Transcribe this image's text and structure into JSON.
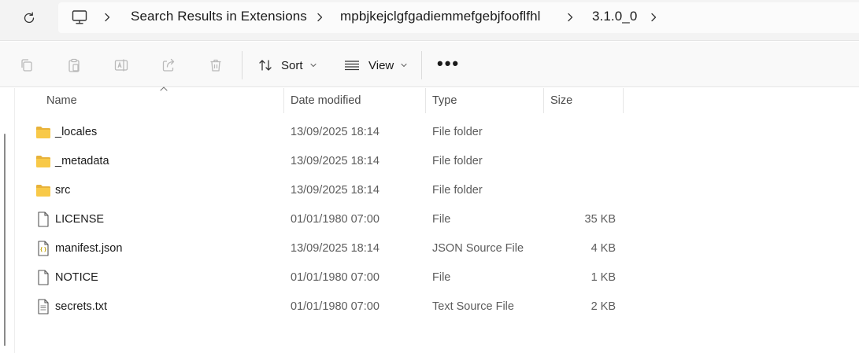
{
  "address_bar": {
    "breadcrumbs": [
      "Search Results in Extensions",
      "mpbjkejclgfgadiemmefgebjfooflfhl",
      "3.1.0_0"
    ]
  },
  "toolbar": {
    "sort_label": "Sort",
    "view_label": "View",
    "more_label": "•••"
  },
  "columns": {
    "name": "Name",
    "date_modified": "Date modified",
    "type": "Type",
    "size": "Size"
  },
  "files": [
    {
      "name": "_locales",
      "date": "13/09/2025 18:14",
      "type": "File folder",
      "size": "",
      "icon": "folder-icon"
    },
    {
      "name": "_metadata",
      "date": "13/09/2025 18:14",
      "type": "File folder",
      "size": "",
      "icon": "folder-icon"
    },
    {
      "name": "src",
      "date": "13/09/2025 18:14",
      "type": "File folder",
      "size": "",
      "icon": "folder-icon"
    },
    {
      "name": "LICENSE",
      "date": "01/01/1980 07:00",
      "type": "File",
      "size": "35 KB",
      "icon": "file-icon"
    },
    {
      "name": "manifest.json",
      "date": "13/09/2025 18:14",
      "type": "JSON Source File",
      "size": "4 KB",
      "icon": "json-file-icon"
    },
    {
      "name": "NOTICE",
      "date": "01/01/1980 07:00",
      "type": "File",
      "size": "1 KB",
      "icon": "file-icon"
    },
    {
      "name": "secrets.txt",
      "date": "01/01/1980 07:00",
      "type": "Text Source File",
      "size": "2 KB",
      "icon": "text-file-icon"
    }
  ],
  "colors": {
    "folder": "#f8c948",
    "folder_dark": "#e8b23a",
    "addressbar_bg": "#f3f3f3",
    "toolbar_bg": "#f9f9f9"
  }
}
